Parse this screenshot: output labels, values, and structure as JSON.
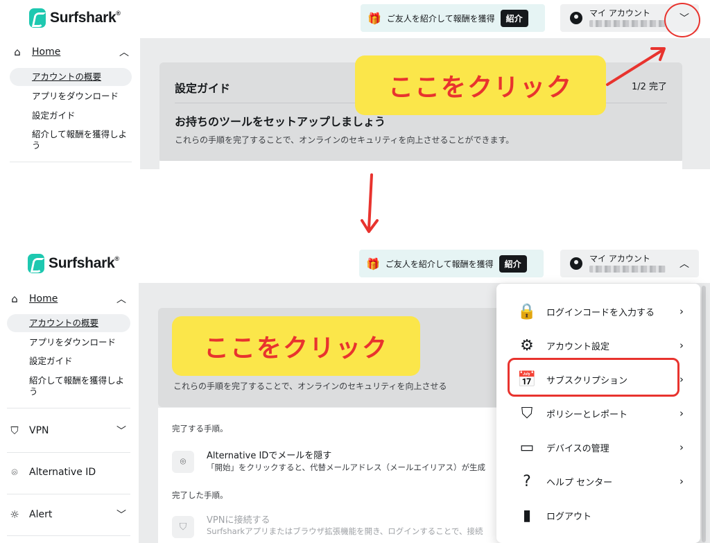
{
  "brand": {
    "name": "Surfshark",
    "reg": "®",
    "accent": "#1ec8b0"
  },
  "top": {
    "refer_text": "ご友人を紹介して報酬を獲得",
    "refer_button": "紹介",
    "account_label": "マイ アカウント"
  },
  "sidebar": {
    "home": "Home",
    "sub": [
      "アカウントの概要",
      "アプリをダウンロード",
      "設定ガイド",
      "紹介して報酬を獲得しよう"
    ],
    "sections": [
      "VPN",
      "Alternative ID",
      "Alert"
    ]
  },
  "guide": {
    "title": "設定ガイド",
    "progress": "1/2 完了",
    "heading": "お持ちのツールをセットアップしましょう",
    "desc": "これらの手順を完了することで、オンラインのセキュリティを向上させることができます。",
    "desc_trunc": "これらの手順を完了することで、オンラインのセキュリティを向上させる"
  },
  "steps": {
    "todo_label": "完了する手順。",
    "done_label": "完了した手順。",
    "alt_title": "Alternative IDでメールを隠す",
    "alt_desc": "「開始」をクリックすると、代替メールアドレス（メールエイリアス）が生成",
    "vpn_title": "VPNに接続する",
    "vpn_desc": "Surfsharkアプリまたはブラウザ拡張機能を開き、ログインすることで、接続"
  },
  "menu": [
    {
      "label": "ログインコードを入力する",
      "icon": "lock-code-icon"
    },
    {
      "label": "アカウント設定",
      "icon": "gear-icon"
    },
    {
      "label": "サブスクリプション",
      "icon": "calendar-icon"
    },
    {
      "label": "ポリシーとレポート",
      "icon": "shield-at-icon"
    },
    {
      "label": "デバイスの管理",
      "icon": "devices-icon"
    },
    {
      "label": "ヘルプ センター",
      "icon": "help-icon"
    },
    {
      "label": "ログアウト",
      "icon": "logout-icon"
    }
  ],
  "annotations": {
    "click_here": "ここをクリック",
    "color": "#e8332e",
    "callout_bg": "#fbe64a"
  }
}
